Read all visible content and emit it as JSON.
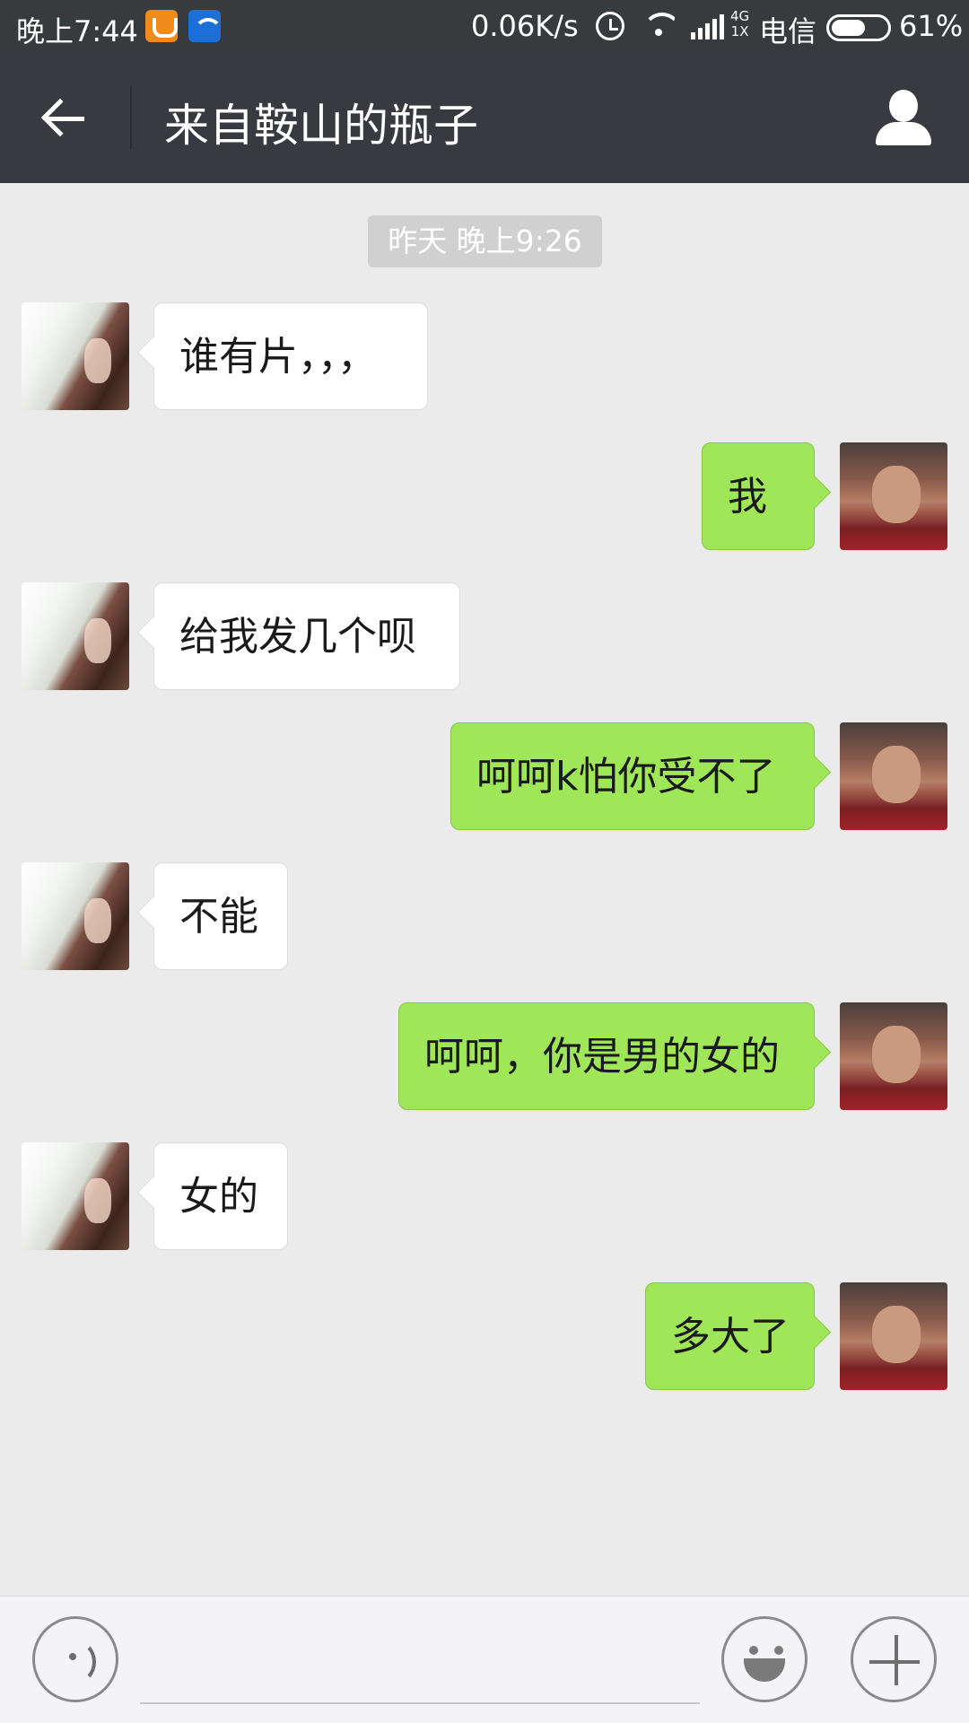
{
  "status_bar": {
    "time": "晚上7:44",
    "net_speed": "0.06K/s",
    "network_top": "4G",
    "network_bottom": "1X",
    "carrier": "电信",
    "battery_percent": "61%",
    "battery_level": 0.61,
    "icons": [
      "uc-browser-icon",
      "wifi-app-icon",
      "alarm-icon",
      "wifi-icon",
      "signal-icon",
      "battery-icon"
    ]
  },
  "header": {
    "title": "来自鞍山的瓶子",
    "back_icon": "back-arrow-icon",
    "profile_icon": "person-icon"
  },
  "chat": {
    "timestamp": "昨天 晚上9:26",
    "messages": [
      {
        "from": "other",
        "text": "谁有片，，，"
      },
      {
        "from": "me",
        "text": "我"
      },
      {
        "from": "other",
        "text": "给我发几个呗"
      },
      {
        "from": "me",
        "text": "呵呵k怕你受不了"
      },
      {
        "from": "other",
        "text": "不能"
      },
      {
        "from": "me",
        "text": "呵呵，你是男的女的"
      },
      {
        "from": "other",
        "text": "女的"
      },
      {
        "from": "me",
        "text": "多大了"
      }
    ]
  },
  "input_bar": {
    "voice_icon": "voice-icon",
    "emoji_icon": "emoji-icon",
    "plus_icon": "plus-icon",
    "input_value": ""
  },
  "colors": {
    "header_bg": "#393a3f",
    "chat_bg": "#ebebeb",
    "outgoing_bubble": "#9fe658",
    "incoming_bubble": "#ffffff"
  }
}
